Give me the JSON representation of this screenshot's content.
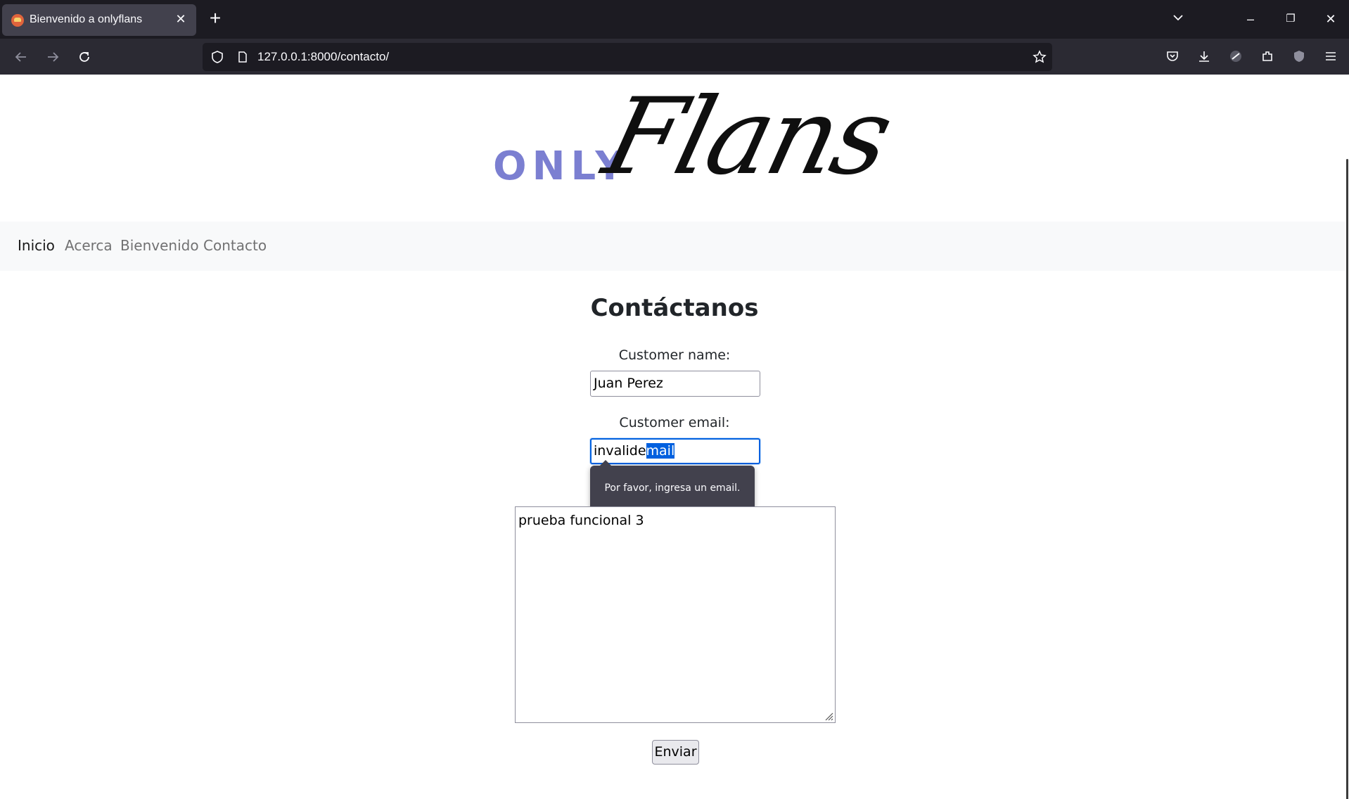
{
  "browser": {
    "tab": {
      "title": "Bienvenido a onlyflans",
      "close_glyph": "✕",
      "favicon": "flan-favicon-icon"
    },
    "new_tab_glyph": "+",
    "url": "127.0.0.1:8000/contacto/",
    "window_controls": {
      "minimize": "–",
      "restore": "❐",
      "close": "✕"
    },
    "colors": {
      "titlebar": "#1c1b22",
      "toolbar": "#2b2a33",
      "active_tab": "#42414d",
      "text": "#fbfbfe"
    }
  },
  "site": {
    "logo": {
      "prefix": "ONLY",
      "script": "Flans",
      "prefix_color": "#7b7fd1"
    },
    "nav": [
      {
        "label": "Inicio",
        "active": true
      },
      {
        "label": "Acerca",
        "active": false
      },
      {
        "label": "Bienvenido",
        "active": false
      },
      {
        "label": "Contacto",
        "active": false
      }
    ]
  },
  "form": {
    "title": "Contáctanos",
    "name_label": "Customer name:",
    "name_value": "Juan Perez",
    "email_label": "Customer email:",
    "email_value_plain": "invalide",
    "email_value_selected": "mail",
    "validation_message": "Por favor, ingresa un email.",
    "message_value": "prueba funcional 3",
    "submit_label": "Enviar",
    "focus_color": "#0060df"
  }
}
